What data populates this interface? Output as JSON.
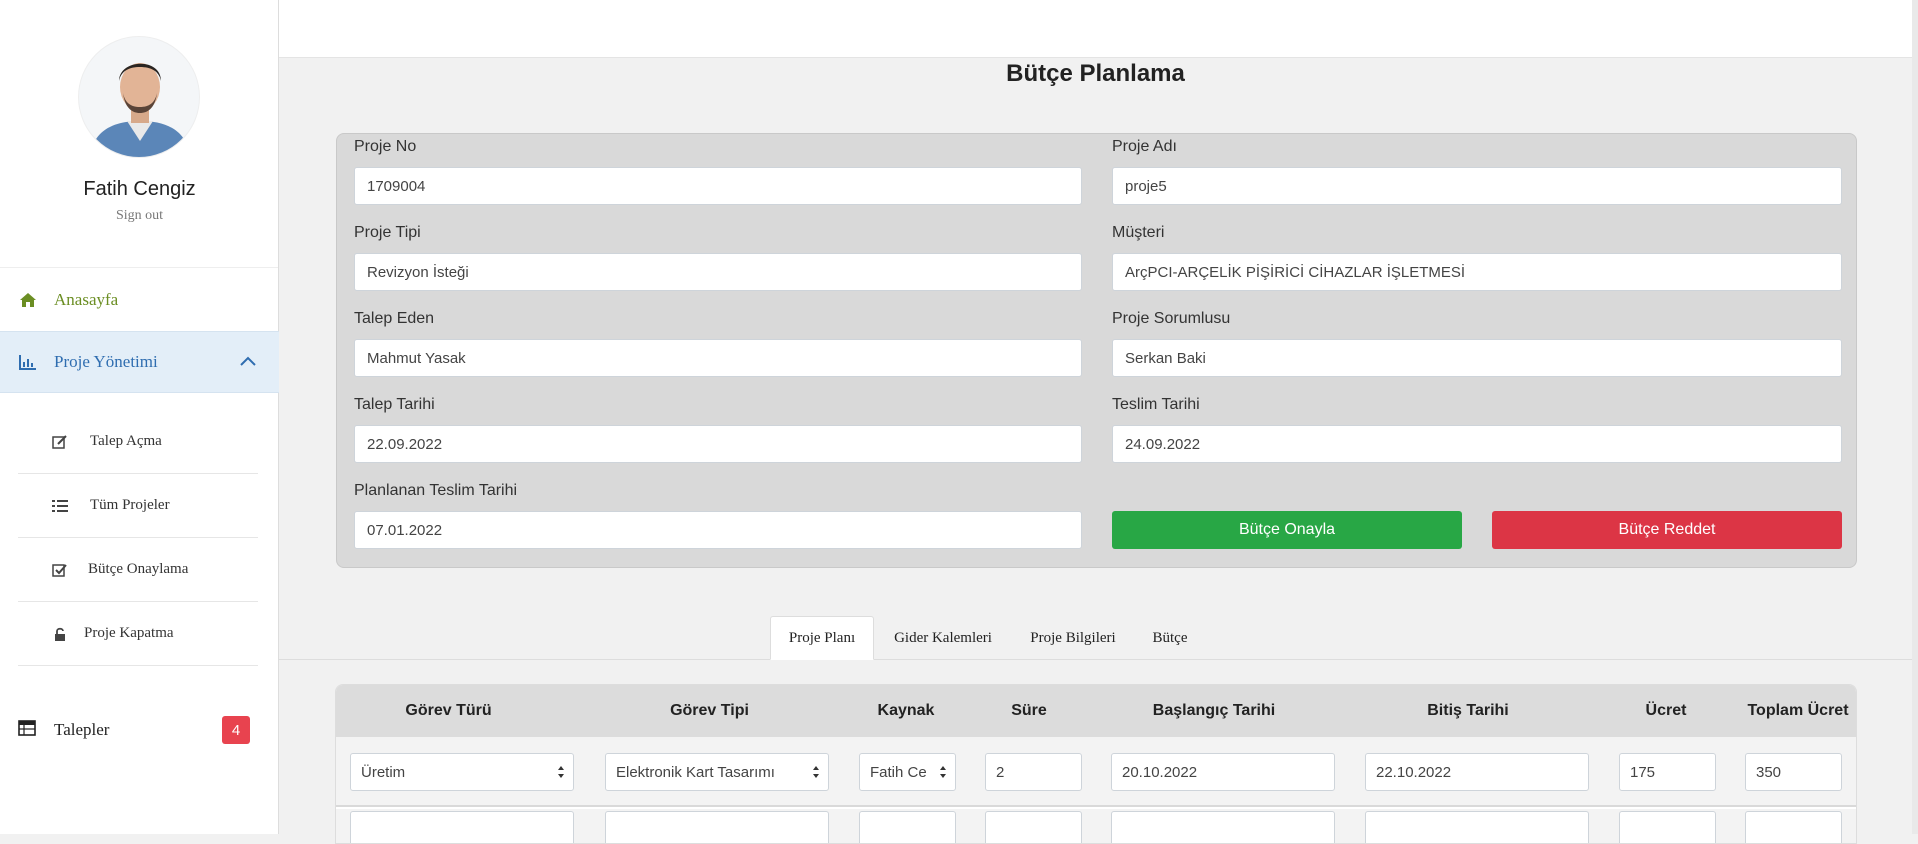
{
  "user": {
    "name": "Fatih Cengiz",
    "sign_out": "Sign out"
  },
  "sidebar": {
    "home": "Anasayfa",
    "proje_yonetimi": "Proje Yönetimi",
    "sub_items": [
      {
        "label": "Talep Açma",
        "icon": "edit-icon"
      },
      {
        "label": "Tüm Projeler",
        "icon": "list-icon"
      },
      {
        "label": "Bütçe Onaylama",
        "icon": "check-square-icon"
      },
      {
        "label": "Proje Kapatma",
        "icon": "unlock-icon"
      }
    ],
    "talepler": {
      "label": "Talepler",
      "count": "4"
    }
  },
  "page": {
    "title": "Bütçe Planlama"
  },
  "form": {
    "proje_no": {
      "label": "Proje No",
      "value": "1709004"
    },
    "proje_adi": {
      "label": "Proje Adı",
      "value": "proje5"
    },
    "proje_tipi": {
      "label": "Proje Tipi",
      "value": "Revizyon İsteği"
    },
    "musteri": {
      "label": "Müşteri",
      "value": "ArçPCI-ARÇELİK PİŞİRİCİ CİHAZLAR İŞLETMESİ"
    },
    "talep_eden": {
      "label": "Talep Eden",
      "value": "Mahmut Yasak"
    },
    "proje_sorumlusu": {
      "label": "Proje Sorumlusu",
      "value": "Serkan Baki"
    },
    "talep_tarihi": {
      "label": "Talep Tarihi",
      "value": "22.09.2022"
    },
    "teslim_tarihi": {
      "label": "Teslim Tarihi",
      "value": "24.09.2022"
    },
    "planlanan_teslim": {
      "label": "Planlanan Teslim Tarihi",
      "value": "07.01.2022"
    },
    "approve_button": "Bütçe Onayla",
    "reject_button": "Bütçe Reddet"
  },
  "tabs": [
    "Proje Planı",
    "Gider Kalemleri",
    "Proje Bilgileri",
    "Bütçe"
  ],
  "table": {
    "headers": [
      "Görev Türü",
      "Görev Tipi",
      "Kaynak",
      "Süre",
      "Başlangıç Tarihi",
      "Bitiş Tarihi",
      "Ücret",
      "Toplam Ücret"
    ],
    "rows": [
      [
        "Üretim",
        "Elektronik Kart Tasarımı",
        "Fatih Ce",
        "2",
        "20.10.2022",
        "22.10.2022",
        "175",
        "350"
      ]
    ]
  },
  "colors": {
    "accent_blue": "#2f6db0",
    "home_green": "#6b8e23",
    "approve": "#28a745",
    "reject": "#dc3545",
    "badge": "#e8434f"
  }
}
